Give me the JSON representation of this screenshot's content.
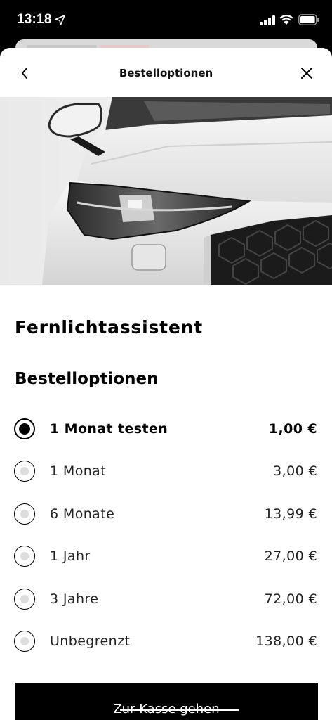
{
  "status_bar": {
    "time": "13:18",
    "icons": [
      "location-arrow-icon",
      "signal-icon",
      "wifi-icon",
      "battery-icon"
    ]
  },
  "nav": {
    "title": "Bestelloptionen",
    "back_icon": "chevron-left-icon",
    "close_icon": "close-icon"
  },
  "hero": {
    "image": "white-car-front-headlight"
  },
  "feature": {
    "title": "Fernlichtassistent"
  },
  "options_section": {
    "title": "Bestelloptionen",
    "options": [
      {
        "label": "1 Monat testen",
        "price": "1,00 €",
        "selected": true
      },
      {
        "label": "1 Monat",
        "price": "3,00 €",
        "selected": false
      },
      {
        "label": "6 Monate",
        "price": "13,99 €",
        "selected": false
      },
      {
        "label": "1 Jahr",
        "price": "27,00 €",
        "selected": false
      },
      {
        "label": "3 Jahre",
        "price": "72,00 €",
        "selected": false
      },
      {
        "label": "Unbegrenzt",
        "price": "138,00 €",
        "selected": false
      }
    ]
  },
  "checkout": {
    "label": "Zur Kasse gehen"
  },
  "colors": {
    "background": "#ffffff",
    "text": "#000000",
    "button": "#000000",
    "button_text": "#ffffff",
    "radio_unselected_dot": "#dddddd"
  }
}
